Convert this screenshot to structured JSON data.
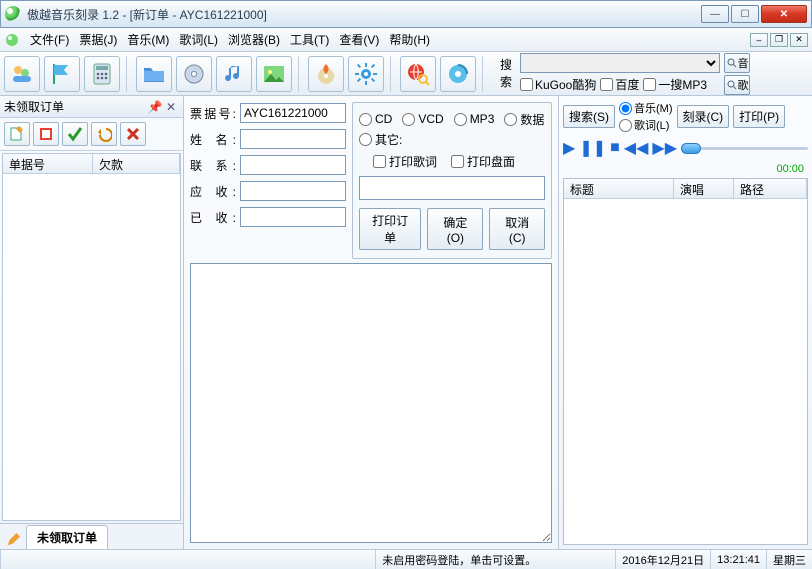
{
  "window": {
    "title": "傲越音乐刻录 1.2 - [新订单 - AYC161221000]"
  },
  "menu": {
    "file": "文件(F)",
    "receipt": "票据(J)",
    "music": "音乐(M)",
    "lyric": "歌词(L)",
    "browser": "浏览器(B)",
    "tool": "工具(T)",
    "view": "查看(V)",
    "help": "帮助(H)"
  },
  "search": {
    "label": "搜索",
    "engines": {
      "kugoo": "KuGoo酷狗",
      "baidu": "百度",
      "yiso": "一搜MP3"
    },
    "btn_music": "音",
    "btn_lyric": "歌"
  },
  "left": {
    "title": "未领取订单",
    "cols": {
      "id": "单据号",
      "due": "欠款"
    },
    "tab": "未领取订单"
  },
  "form": {
    "receipt_label": "票据号:",
    "receipt_value": "AYC161221000",
    "name_label": "姓 名:",
    "contact_label": "联 系:",
    "receivable_label": "应 收:",
    "received_label": "已 收:"
  },
  "mode": {
    "cd": "CD",
    "vcd": "VCD",
    "mp3": "MP3",
    "data": "数据",
    "other": "其它:",
    "print_lyric": "打印歌词",
    "print_cover": "打印盘面"
  },
  "buttons": {
    "print_order": "打印订单",
    "ok": "确定(O)",
    "cancel": "取消(C)",
    "search": "搜索(S)",
    "burn": "刻录(C)",
    "print": "打印(P)",
    "r_music": "音乐(M)",
    "r_lyric": "歌词(L)"
  },
  "player": {
    "time": "00:00"
  },
  "playlist": {
    "title": "标题",
    "artist": "演唱",
    "path": "路径"
  },
  "status": {
    "msg": "未启用密码登陆，单击可设置。",
    "date": "2016年12月21日",
    "time": "13:21:41",
    "weekday": "星期三"
  }
}
